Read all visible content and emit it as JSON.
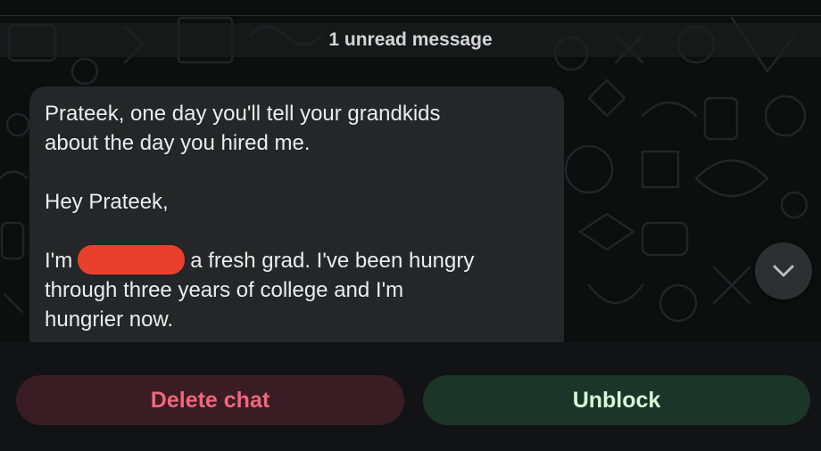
{
  "chat": {
    "unread_banner": "1 unread message",
    "message": {
      "lines": [
        "Prateek, one day you'll tell your grandkids",
        "about the day you hired me.",
        "Hey Prateek,",
        "I'm",
        "a fresh grad. I've been hungry",
        "through three years of college and I'm",
        "hungrier now."
      ],
      "redaction_color": "#e8402d"
    },
    "scroll_down_icon": "chevron-down-icon"
  },
  "actions": {
    "delete_label": "Delete chat",
    "unblock_label": "Unblock"
  },
  "colors": {
    "background": "#0d0e0e",
    "bubble": "#242627",
    "delete_text": "#f0677b",
    "delete_bg": "#3a1c25",
    "unblock_text": "#d6f7d9",
    "unblock_bg": "#1b3528"
  }
}
